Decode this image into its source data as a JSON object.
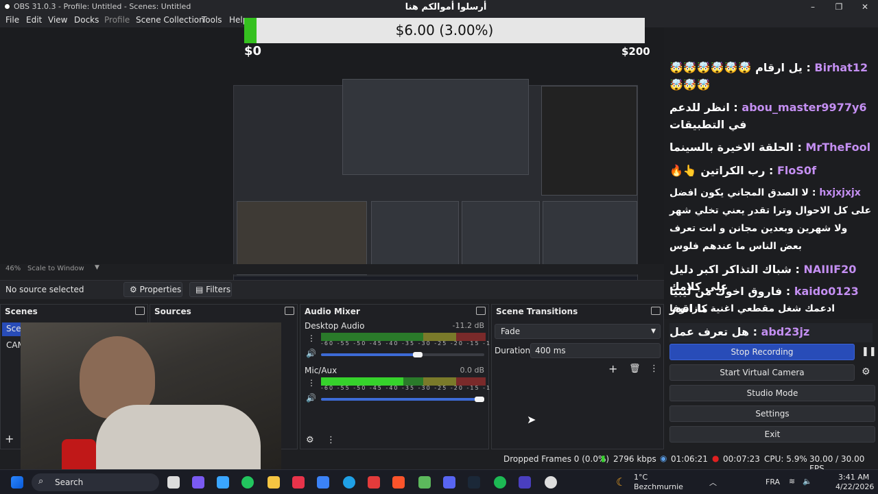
{
  "window": {
    "title": "OBS 31.0.3 - Profile: Untitled - Scenes: Untitled",
    "min_glyph": "–",
    "max_glyph": "❐",
    "close_glyph": "✕"
  },
  "menu": [
    "File",
    "Edit",
    "View",
    "Docks",
    "Profile",
    "Scene Collection",
    "Tools",
    "Help"
  ],
  "donation": {
    "title": "أرسلوا أموالكم هنا",
    "amount": "$6.00 (3.00%)",
    "min": "$0",
    "max": "$200",
    "progress_fraction": 0.03,
    "bar_color": "#35c11f"
  },
  "preview": {
    "zoom": "46%",
    "scale_mode": "Scale to Window"
  },
  "source_bar": {
    "no_source": "No source selected",
    "properties": "Properties",
    "filters": "Filters"
  },
  "docks": {
    "scenes": {
      "title": "Scenes",
      "items": [
        "Scene",
        "CAM"
      ]
    },
    "sources": {
      "title": "Sources"
    },
    "audio_mixer": {
      "title": "Audio Mixer",
      "channels": [
        {
          "name": "Desktop Audio",
          "db": "-11.2 dB",
          "volume_fraction": 0.62
        },
        {
          "name": "Mic/Aux",
          "db": "0.0 dB",
          "volume_fraction": 1.0
        }
      ],
      "scale": "-60 -55 -50 -45 -40 -35 -30 -25 -20 -15 -10 -5 0"
    },
    "transitions": {
      "title": "Scene Transitions",
      "selected": "Fade",
      "duration_label": "Duration",
      "duration_value": "400 ms"
    }
  },
  "controls": {
    "stop_recording": "Stop Recording",
    "start_virtual_camera": "Start Virtual Camera",
    "studio_mode": "Studio Mode",
    "settings": "Settings",
    "exit": "Exit"
  },
  "chat": [
    {
      "user": "Birhat12",
      "text": "يل ارقام 🤯🤯🤯🤯🤯🤯🤯🤯🤯"
    },
    {
      "user": "abou_master9977y6",
      "text": "انظر للدعم في التطبيقات"
    },
    {
      "user": "MrTheFool",
      "text": "الحلقة الاخيرة بالسينما"
    },
    {
      "user": "FloS0f",
      "text": "رب الكراتين 👆🔥"
    },
    {
      "user": "hxjxjxjx",
      "text": "لا الصدق المجاني يكون افضل على كل الاحوال وترا تقدر يعني تخلي شهر ولا شهرين وبعدين مجانن و انت تعرف بعض الناس ما عندهم فلوس"
    },
    {
      "user": "NAIIIF20",
      "text": "شباك التذاكر اكبر دليل على كلامك"
    },
    {
      "user": "kaido0123",
      "text": "فاروق اخوك من ليبيا ما اقدر"
    },
    {
      "user": "",
      "text": "ادعمك شغل مقطعي اغنية كازانوفا"
    },
    {
      "user": "abd23jz",
      "text": "هل تعرف عمل invincible"
    }
  ],
  "status": {
    "dropped_frames": "Dropped Frames 0 (0.0%)",
    "bitrate": "2796 kbps",
    "stream_time": "01:06:21",
    "rec_time": "00:07:23",
    "cpu": "CPU: 5.9%",
    "fps": "30.00 / 30.00 FPS"
  },
  "taskbar": {
    "search": "Search",
    "weather_temp": "1°C",
    "weather_loc": "Bezchmurnie",
    "lang": "FRA",
    "time": "3:41 AM",
    "date": "4/22/2026"
  },
  "colors": {
    "accent": "#284cb8",
    "chat_user": "#c48ff2",
    "record": "#e02020"
  }
}
